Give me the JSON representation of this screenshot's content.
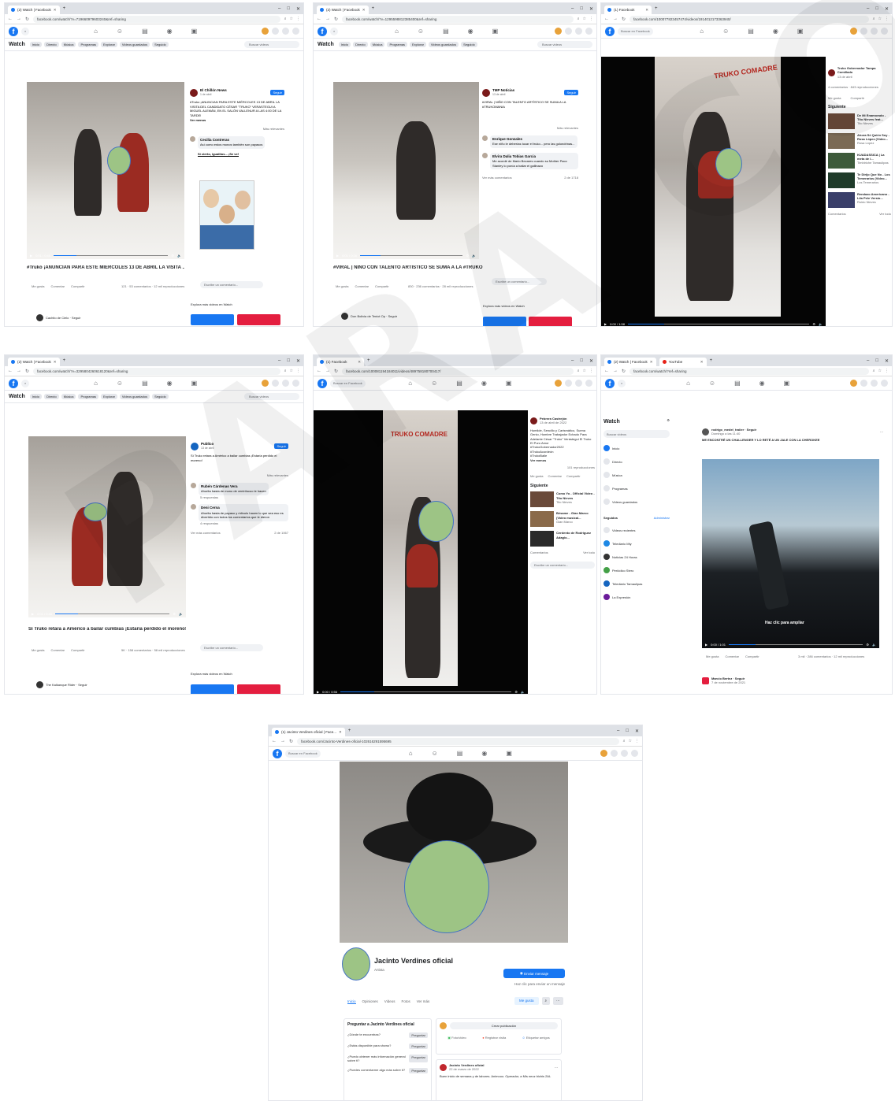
{
  "browser": {
    "tab_watch": "(2) Watch | Facebook",
    "tab_facebook": "(1) Facebook",
    "tab_youtube": "YouTube",
    "tab_profile": "(1) Jacinto Verdines oficial | Face...",
    "url_p1": "facebook.com/watch/?v=719660979603240&ref=sharing",
    "url_p2": "facebook.com/watch/?v=1295598812385400&ref=sharing",
    "url_p3": "facebook.com/100077823457474/videos/1914012173363940/",
    "url_p4": "facebook.com/watch/?v=3295804260618120&ref=sharing",
    "url_p5": "facebook.com/100081194184011/videos/489758180700417/",
    "url_p6": "facebook.com/watch/?ref=sharing",
    "url_p7": "facebook.com/Jacinto-Verdines-oficial-102616291595695",
    "search_placeholder": "Buscar en Facebook"
  },
  "watch_nav": {
    "title": "Watch",
    "items": [
      "Inicio",
      "Directo",
      "Música",
      "Programas",
      "Explorar",
      "Videos guardados",
      "Seguido"
    ],
    "search": "Buscar videos"
  },
  "p1": {
    "page": "El Chillón News",
    "meta": "1 de abril",
    "follow": "Seguir",
    "post": "#Truko ¡ANUNCIAN PARA ESTE MIÉRCOLES 13 DE ABRIL LA VISITA DEL CANDIDATO CÉSAR \"TRUKO\" VERASTEGUI A MIGUEL ALEMÁN, EN EL SALÓN VALLENUR A LAS 4:00 DE LA TARDE!",
    "see_more": "Ver menos",
    "relevant": "Más relevantes",
    "comment_name": "Cecilia Contreras",
    "comment_text": "Así como estos monos también son payasos",
    "cartoon_caption": "Sí cierto, igualitos... ¡Se ve!",
    "title": "#Truko ¡ANUNCIAN PARA ESTE MIÉRCOLES 13 DE ABRIL LA VISITA ...",
    "actions": [
      "Me gusta",
      "Comentar",
      "Compartir"
    ],
    "stats": "121 · 53 comentarios · 12 mil reproducciones",
    "comment_box": "Escribe un comentario...",
    "more": "Explora más videos en Watch",
    "channel": "Cachito de Cielo · Seguir",
    "time": "0:01 / 0:45"
  },
  "p2": {
    "page": "TMP Noticias",
    "meta": "13 de abril",
    "follow": "Seguir",
    "post": "#VIRAL | NIÑO CON TALENTO ARTÍSTICO SE SUMA A LA #TRUKOMANIA",
    "relevant": "Más relevantes",
    "c1_name": "Enrique Gonzales",
    "c1_text": "Ese niño le deberías tocar el truko... pero las golondrinas...",
    "c2_name": "Elvira Dalia Tobias Garcia",
    "c2_text": "Me acordé de Mario Bezares cuando su Mother Paco Stanley lo ponía a bailar el gallinazo",
    "see_more_c": "Ver más comentarios",
    "count": "2 de 1718",
    "title": "#VIRAL | NIÑO CON TALENTO ARTÍSTICO SE SUMA A LA #TRUKO...",
    "stats": "830 · 236 comentarios · 28 mil reproducciones",
    "comment_box": "Escribe un comentario...",
    "more": "Explora más videos en Watch",
    "channel": "Don Bolivia de Teniot Op · Seguir",
    "time": "0:01 / 0:16"
  },
  "p3": {
    "page": "Truko Gobernador Tampa Comillado",
    "meta": "13 de abril",
    "stats": "4 comentarios · 843 reproducciones",
    "actions": [
      "Me gusta",
      "Compartir"
    ],
    "next": "Siguiente",
    "items": [
      {
        "title": "De Mi Enamorado - Tito Nieves feat...",
        "sub": "Tito Nieves"
      },
      {
        "title": "Ahora Sé Quién Soy - Rosa López (Video...",
        "sub": "Rosa López"
      },
      {
        "title": "KUADASSICA | La meta de l...",
        "sub": "Timbiriche Tamaulipas"
      },
      {
        "title": "Te Dirijo Que No - Los Temerarios (Video...",
        "sub": "Los Temerarios"
      },
      {
        "title": "Rendazo Americano - Lila Pele Versio...",
        "sub": "Ruido Nieves"
      }
    ],
    "comments": "Comentarios",
    "see_all": "Ver todo",
    "time": "0:00 / 1:58",
    "banner": "TRUKO COMADRE"
  },
  "p4": {
    "page": "Publico",
    "meta": "13 de abril",
    "follow": "Seguir",
    "post": "Sí Truko retara a Américo a bailar cumbias ¡Estaría perdido el moreno!",
    "relevant": "Más relevantes",
    "c1_name": "Rubén Cárdenas Vera",
    "c1_text": "Ahorita hasta de mono de ventrílocuo le hacen",
    "c1_reply": "5 respuestas",
    "c2_name": "Deni Cerna",
    "c2_text": "Ahorita hasta de payaso y ridículo hacen lo que sea eso es divertido con todos los comentarios que le dieron",
    "c2_reply": "4 respuestas",
    "see_more_c": "Ver más comentarios",
    "count": "2 de 1067",
    "title": "Sí Truko retara a Américo a bailar cumbias ¡Estaría perdido el moreno!!",
    "stats": "5K · 158 comentarios · 58 mil reproducciones",
    "comment_box": "Escribe un comentario...",
    "more": "Explora más videos en Watch",
    "channel": "The Kalkanque Rider · Seguir",
    "time": "0:01 / 0:45"
  },
  "p5": {
    "page": "Pebrera Castrejón",
    "meta": "13 de abril de 2022",
    "post": "Humilde, Sencillo y Carismático, Suena Genio, Hombre Trabajador Echado Para Adelante César \"Truko\" Verástegui El Truko El Puro Amor",
    "tags": [
      "#TrukoGobernador2022",
      "#TrukoAcordeón",
      "#TrukoBaile"
    ],
    "see_more": "Ver menos",
    "stats": "101 reproducciones",
    "actions": [
      "Me gusta",
      "Comentar",
      "Compartir"
    ],
    "next": "Siguiente",
    "items": [
      {
        "title": "Como Yo - Official Video - Tito Nieves",
        "sub": "Tito Nieves"
      },
      {
        "title": "Bésame - Gian Marco (Video musical...",
        "sub": "Gian Marco"
      },
      {
        "title": "Cerdento de Rodriguez Adagio...",
        "sub": ""
      }
    ],
    "comments": "Comentarios",
    "see_all": "Ver todo",
    "comment_box": "Escribe un comentario...",
    "time": "0:00 / 0:56",
    "banner": "TRUKO COMADRE"
  },
  "p6": {
    "title": "Watch",
    "search": "Buscar videos",
    "menu": [
      "Inicio",
      "Directo",
      "Música",
      "Programas",
      "Videos guardados"
    ],
    "following": "Seguidos",
    "manage": "Administrar",
    "recent": "Videos recientes",
    "pages": [
      "Telediario Mty",
      "Noticias 24 Horas",
      "Periódico Stero",
      "Telediario Tamaulipas",
      "La Expresión"
    ],
    "poster": "rodrigo_medel_traiier · Seguir",
    "poster_meta": "Domingo a las 11:40",
    "post": "ME ENCONTRÉ UN CHALLENGER Y LO RETÉ A UN JALE CON LA CHEROKEE",
    "hint": "Haz clic para ampliar",
    "actions": [
      "Me gusta",
      "Comentar",
      "Compartir"
    ],
    "stats": "3 mil · 286 comentarios · 12 mil reproducciones",
    "next_poster": "Marcio Bertez · Seguir",
    "next_meta": "7 de noviembre de 2021",
    "time": "0:00 / 1:01"
  },
  "p7": {
    "name": "Jacinto Verdines oficial",
    "type": "Artista",
    "send": "Enviar mensaje",
    "send_sub": "Haz clic para enviar un mensaje",
    "tabs": [
      "Inicio",
      "Opiniones",
      "Videos",
      "Fotos",
      "Ver más"
    ],
    "liked": "Me gusta",
    "ask_title": "Preguntar a Jacinto Verdines oficial",
    "questions": [
      "¿Dónde te encuentras?",
      "¿Estás disponible para shows?",
      "¿Puedo obtener más información general sobre ti?",
      "¿Puedes comentarme algo más sobre ti?"
    ],
    "ask_btn": "Preguntar",
    "create": "Crear publicación",
    "photo": "Foto/video",
    "checkin": "Registrar visita",
    "tag": "Etiquetar amigos",
    "post_name": "Jacinto Verdines oficial",
    "post_meta": "22 de marzo de 2022",
    "post_text": "Buen inicio de semana y de labores. Animooo. Operador, a Mis neoz bichis 2AL"
  },
  "watermark": "PARA CONSULTA"
}
